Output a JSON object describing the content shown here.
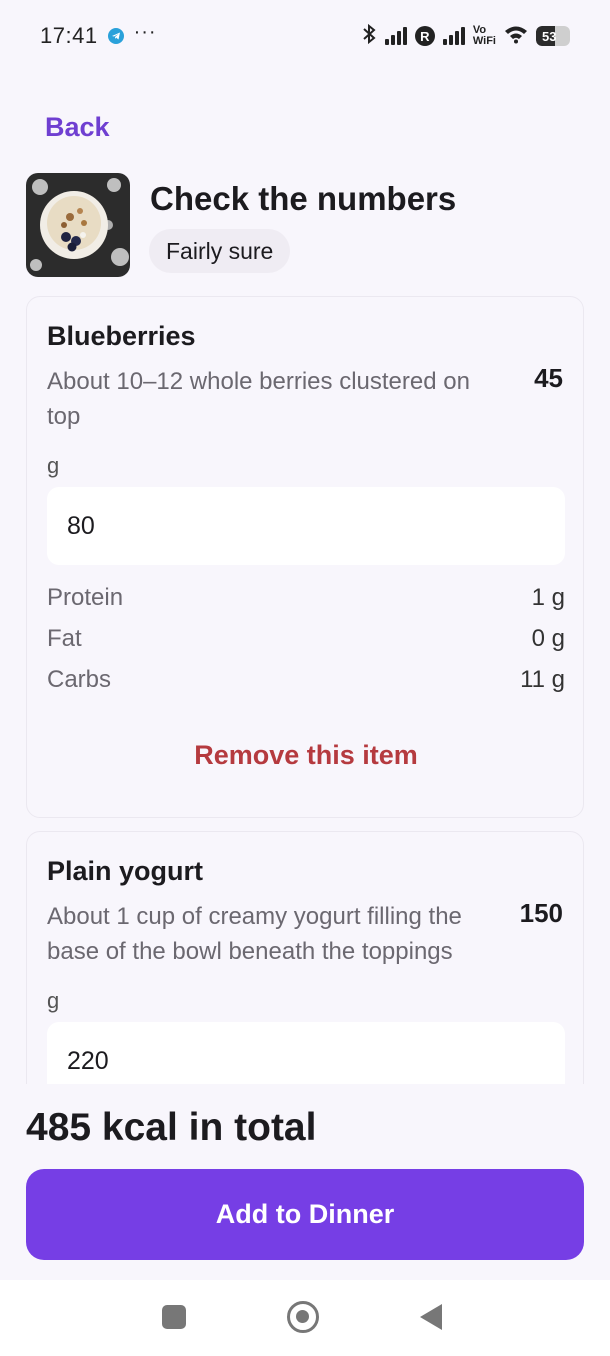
{
  "status_bar": {
    "time": "17:41",
    "notification_icons": [
      "telegram-icon",
      "more-dots-icon"
    ],
    "system_icons": [
      "bluetooth-icon",
      "signal-icon",
      "roaming-r-icon",
      "signal-icon",
      "vowifi-icon",
      "wifi-icon",
      "battery-icon"
    ],
    "vowifi_top": "Vo",
    "vowifi_bottom": "WiFi",
    "roaming_label": "R",
    "battery_level": "53"
  },
  "nav": {
    "back_label": "Back"
  },
  "header": {
    "title": "Check the numbers",
    "confidence_label": "Fairly sure"
  },
  "items": [
    {
      "name": "Blueberries",
      "kcal": "45",
      "description": "About 10–12 whole berries clustered on top",
      "unit": "g",
      "quantity": "80",
      "macros": [
        {
          "label": "Protein",
          "value": "1 g"
        },
        {
          "label": "Fat",
          "value": "0 g"
        },
        {
          "label": "Carbs",
          "value": "11 g"
        }
      ],
      "remove_label": "Remove this item"
    },
    {
      "name": "Plain yogurt",
      "kcal": "150",
      "description": "About 1 cup of creamy yogurt filling the base of the bowl beneath the toppings",
      "unit": "g",
      "quantity": "220"
    }
  ],
  "summary": {
    "total_label": "485 kcal in total",
    "add_button_label": "Add to Dinner"
  },
  "colors": {
    "accent": "#763ee5",
    "link": "#6f3fd1",
    "danger": "#b53a3f",
    "background": "#f8f6fc"
  }
}
